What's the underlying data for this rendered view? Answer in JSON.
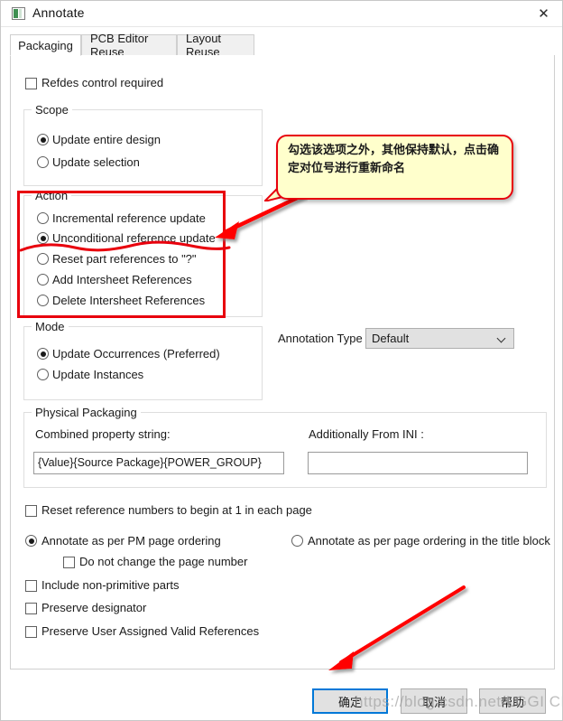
{
  "window": {
    "title": "Annotate",
    "icon": "app-window-icon",
    "close_label": "✕"
  },
  "tabs": [
    {
      "label": "Packaging",
      "active": true
    },
    {
      "label": "PCB Editor Reuse",
      "active": false
    },
    {
      "label": "Layout Reuse",
      "active": false
    }
  ],
  "top": {
    "refdes_control": {
      "label": "Refdes control required",
      "checked": false
    }
  },
  "scope": {
    "title": "Scope",
    "options": [
      {
        "label": "Update entire design",
        "selected": true
      },
      {
        "label": "Update selection",
        "selected": false
      }
    ]
  },
  "action": {
    "title": "Action",
    "options": [
      {
        "label": "Incremental reference update",
        "selected": false
      },
      {
        "label": "Unconditional reference update",
        "selected": true
      },
      {
        "label": "Reset part references to \"?\"",
        "selected": false
      },
      {
        "label": "Add Intersheet References",
        "selected": false
      },
      {
        "label": "Delete Intersheet References",
        "selected": false
      }
    ]
  },
  "mode": {
    "title": "Mode",
    "options": [
      {
        "label": "Update Occurrences (Preferred)",
        "selected": true
      },
      {
        "label": "Update Instances",
        "selected": false
      }
    ]
  },
  "annotation_type": {
    "label": "Annotation Type",
    "value": "Default",
    "caret": "chevron-down-icon"
  },
  "physical_packaging": {
    "title": "Physical Packaging",
    "combined_label": "Combined property string:",
    "combined_value": "{Value}{Source Package}{POWER_GROUP}",
    "ini_label": "Additionally From INI :",
    "ini_value": ""
  },
  "bottom_options": {
    "reset_numbers": {
      "label": "Reset reference numbers to begin at 1 in each page",
      "checked": false
    },
    "pm_page_ordering": {
      "label": "Annotate as per PM page ordering",
      "selected": true
    },
    "title_block_ordering": {
      "label": "Annotate as per page ordering in the title block",
      "selected": false
    },
    "do_not_change_page": {
      "label": "Do not change the page number",
      "checked": false
    },
    "include_non_primitive": {
      "label": "Include non-primitive parts",
      "checked": false
    },
    "preserve_designator": {
      "label": "Preserve designator",
      "checked": false
    },
    "preserve_user_assigned": {
      "label": "Preserve User Assigned Valid References",
      "checked": false
    }
  },
  "buttons": {
    "ok": "确定",
    "cancel": "取消",
    "help": "帮助"
  },
  "annotations": {
    "callout_text": "勾选该选项之外，其他保持默认，点击确定对位号进行重新命名",
    "highlight_color": "#e8000d",
    "callout_bg": "#ffffcc"
  },
  "watermark": "https://blog.csdn.net/LGGI CB"
}
